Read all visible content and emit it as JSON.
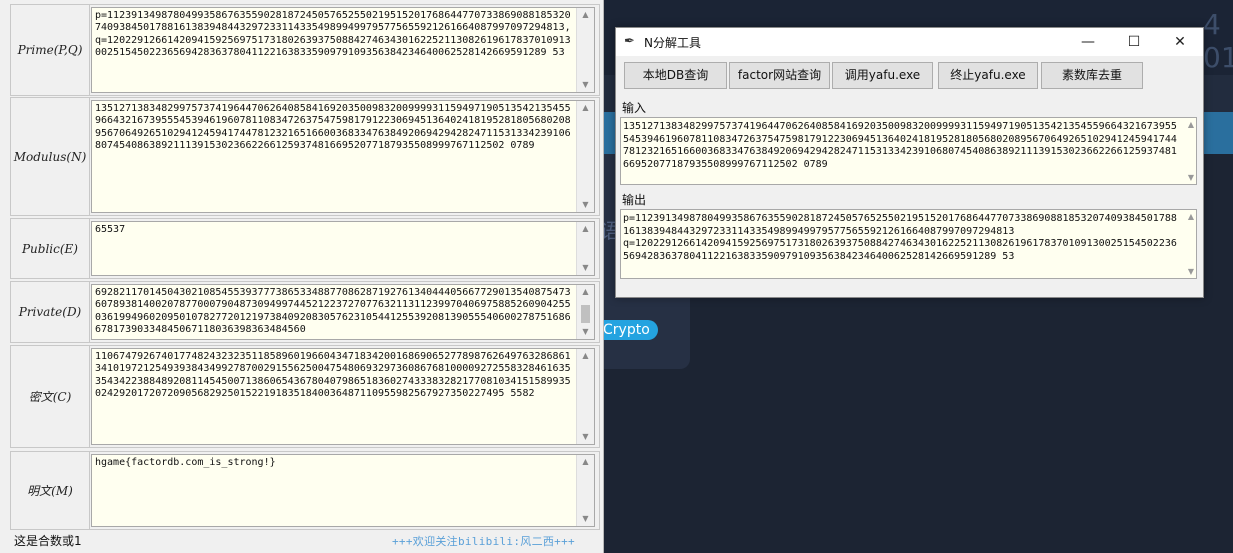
{
  "background": {
    "digits": "4  01",
    "fragment": "语",
    "crypto_tag": "Crypto"
  },
  "left": {
    "fields": [
      {
        "label": "Prime(P,Q)",
        "value": "p=11239134987804993586763559028187245057652550219515201768644770733869088185320740938450178816138394844329723311433549899499795775655921261664087997097294813, q=12022912661420941592569751731802639375088427463430162252113082619617837010913002515450223656942836378041122163833590979109356384234640062528142669591289 53"
      },
      {
        "label": "Modulus(N)",
        "value": "13512713834829975737419644706264085841692035009832009999311594971905135421354559664321673955545394619607811083472637547598179122306945136402418195281805680208956706492651029412459417447812321651660036833476384920694294282471153133423910680745408638921113915302366226612593748166952077187935508999767112502 0789"
      },
      {
        "label": "Public(E)",
        "value": "65537"
      },
      {
        "label": "Private(D)",
        "value": "69282117014504302108545539377738653348877086287192761340444056677290135408754736078938140020787700079048730949974452122372707763211311239970406975885260904255036199496020950107827720121973840920830576231054412553920813905554060027875168667817390334845067118036398363484560"
      },
      {
        "label": "密文(C)",
        "value": "11067479267401774824323235118589601966043471834200168690652778987626497632868613410197212549393843499278700291556250047548069329736086768100009272558328461635354342238848920811454500713860654367804079865183602743338328217708103415158993502429201720720905682925015221918351840036487110955982567927350227495 5582"
      },
      {
        "label": "明文(M)",
        "value": "hgame{factordb.com_is_strong!}"
      }
    ],
    "status": "这是合数或1",
    "credit": "+++欢迎关注bilibili:风二西+++"
  },
  "tool_window": {
    "title": "N分解工具",
    "buttons": [
      "本地DB查询",
      "factor网站查询",
      "调用yafu.exe",
      "终止yafu.exe",
      "素数库去重"
    ],
    "input_label": "输入",
    "input_value": "13512713834829975737419644706264085841692035009832009999311594971905135421354559664321673955545394619607811083472637547598179122306945136402418195281805680208956706492651029412459417447812321651660036833476384920694294282471153133423910680745408638921113915302366226612593748166952077187935508999767112502 0789",
    "output_label": "输出",
    "output_value": "p=11239134987804993586763559028187245057652550219515201768644770733869088185320740938450178816138394844329723311433549899499795775655921261664087997097294813\nq=12022912661420941592569751731802639375088427463430162252113082619617837010913002515450223656942836378041122163833590979109356384234640062528142669591289 53"
  }
}
